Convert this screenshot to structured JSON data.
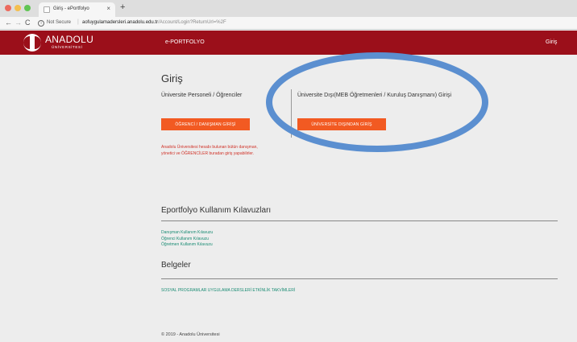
{
  "browser": {
    "tab_title": "Giriş - ePortfolyo",
    "tab_close": "×",
    "new_tab": "+",
    "nav_back": "←",
    "nav_forward": "→",
    "nav_reload": "C",
    "info_glyph": "i",
    "security_label": "Not Secure",
    "url_separator": "|",
    "url_host": "aofuygulamadersleri.anadolu.edu.tr",
    "url_path": "/Account/Login?ReturnUrl=%2F"
  },
  "header": {
    "logo_name": "ANADOLU",
    "logo_sub": "ÜNİVERSİTESİ",
    "nav_eportfolyo": "e-PORTFOLYO",
    "nav_login": "Giriş"
  },
  "login": {
    "title": "Giriş",
    "university_label": "Üniversite Personeli / Öğrenciler",
    "external_label": "Üniversite Dışı(MEB Öğretmenleri / Kuruluş Danışmanı) Girişi",
    "student_button": "ÖĞRENCİ / DANIŞMAN GİRİŞİ",
    "external_button": "ÜNİVERSİTE DIŞINDAN GİRİŞ",
    "note_lines": [
      "Anadolu Üniversitesi hesabı bulunan bütün danışman,",
      "yönetici ve ÖĞRENCİLER buradan giriş yapabilirler."
    ]
  },
  "guides": {
    "title": "Eportfolyo Kullanım Kılavuzları",
    "links": [
      "Danışman Kullanım Kılavuzu",
      "Öğrenci Kullanım Kılavuzu",
      "Öğretmen Kullanım Kılavuzu"
    ]
  },
  "documents": {
    "title": "Belgeler",
    "link": "SOSYAL PROGRAMLAR UYGULAMA DERSLERİ ETKİNLİK TAKVİMLERİ"
  },
  "footer": {
    "copyright": "© 2019 - Anadolu Üniversitesi"
  },
  "colors": {
    "header_red": "#9b0f1a",
    "button_orange": "#f25a22",
    "note_red": "#d1342a",
    "link_teal": "#1a8c74",
    "annotation_blue": "#5b8fd0"
  }
}
